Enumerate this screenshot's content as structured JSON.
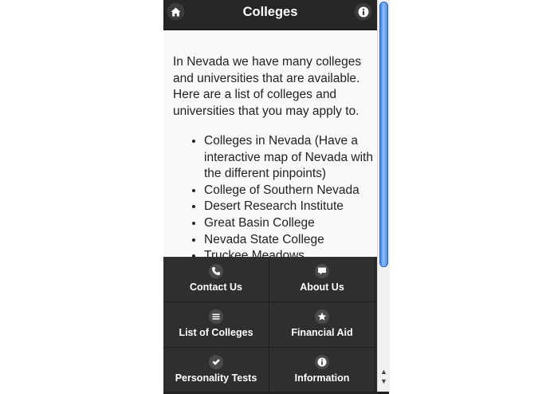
{
  "header": {
    "title": "Colleges",
    "home_icon": "home-icon",
    "info_icon": "info-icon"
  },
  "content": {
    "intro": "In Nevada we have many colleges and universities that are available. Here are a list of colleges and universities that you may apply to.",
    "colleges": [
      "Colleges in Nevada (Have a interactive map of Nevada with the different pinpoints)",
      "College of Southern Nevada",
      "Desert Research Institute",
      "Great Basin College",
      "Nevada State College",
      "Truckee Meadows"
    ]
  },
  "nav": {
    "contact": {
      "label": "Contact Us",
      "icon": "phone-icon"
    },
    "about": {
      "label": "About Us",
      "icon": "chat-bubble-icon"
    },
    "list": {
      "label": "List of Colleges",
      "icon": "list-icon"
    },
    "financial": {
      "label": "Financial Aid",
      "icon": "star-icon"
    },
    "personality": {
      "label": "Personality Tests",
      "icon": "check-icon"
    },
    "information": {
      "label": "Information",
      "icon": "info-icon"
    }
  },
  "colors": {
    "header_bg": "#262626",
    "tile_bg": "#2f2f2f",
    "content_bg": "#f9f9f9",
    "scroll_thumb": "#4d8be6"
  }
}
